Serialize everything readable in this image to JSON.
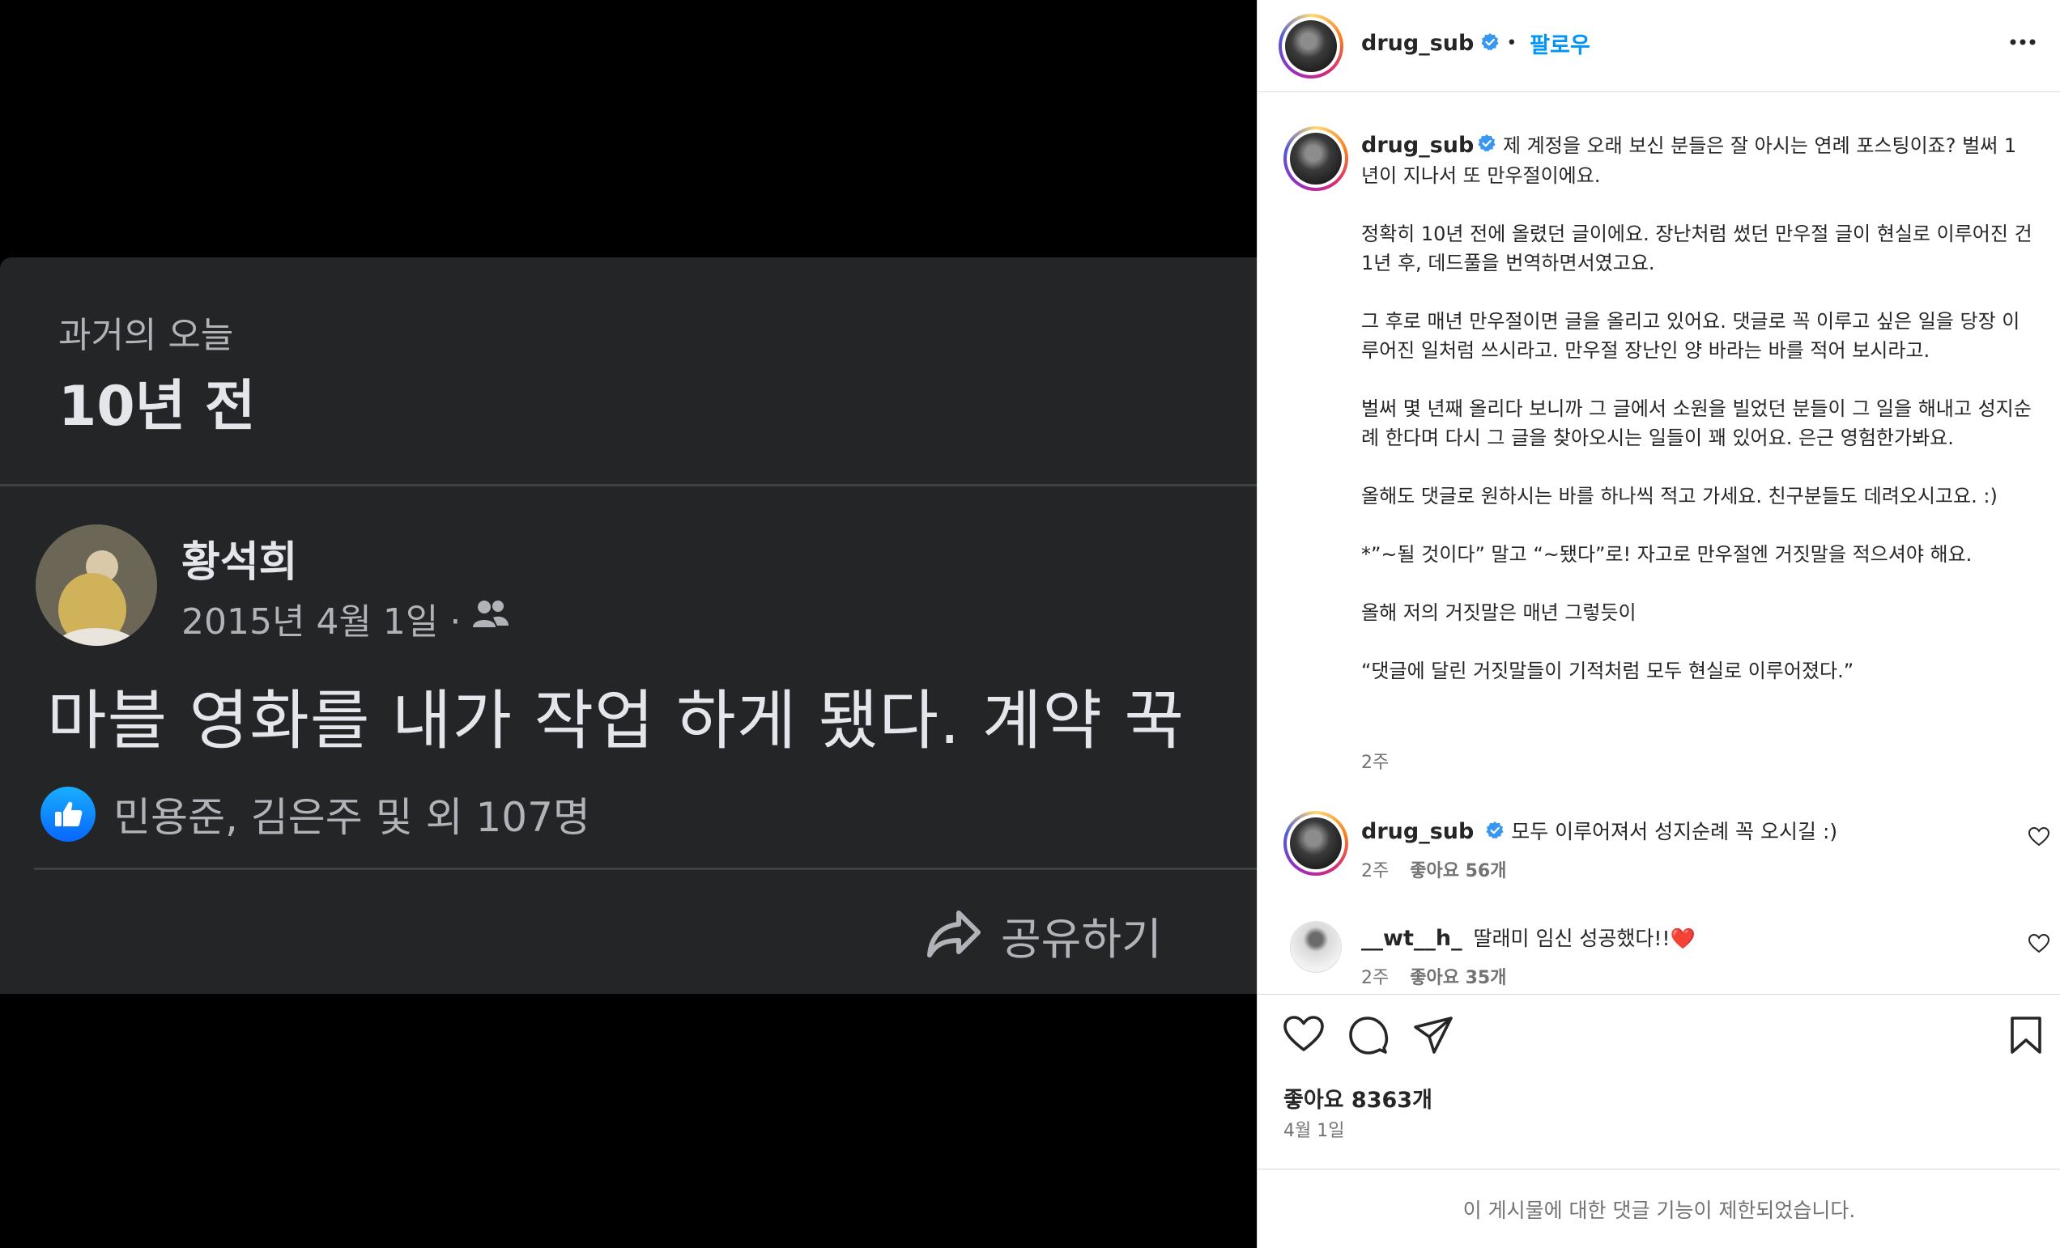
{
  "media": {
    "memory_label": "과거의 오늘",
    "years_ago": "10년 전",
    "author": "황석희",
    "date": "2015년 4월 1일 ·",
    "post_text": "마블 영화를 내가 작업 하게 됐다. 계약 꾹",
    "likes_text": "민용준, 김은주 및 외 107명",
    "share_label": "공유하기"
  },
  "header": {
    "username": "drug_sub",
    "separator": "•",
    "follow_label": "팔로우"
  },
  "caption": {
    "username": "drug_sub",
    "text": "제 계정을 오래 보신 분들은 잘 아시는 연례 포스팅이죠? 벌써 1년이 지나서 또 만우절이에요.\n\n정확히 10년 전에 올렸던 글이에요. 장난처럼 썼던 만우절 글이 현실로 이루어진 건 1년 후, 데드풀을 번역하면서였고요.\n\n그 후로 매년 만우절이면 글을 올리고 있어요. 댓글로 꼭 이루고 싶은 일을 당장 이루어진 일처럼 쓰시라고. 만우절 장난인 양 바라는 바를 적어 보시라고.\n\n벌써 몇 년째 올리다 보니까 그 글에서 소원을 빌었던 분들이 그 일을 해내고 성지순례 한다며 다시 그 글을 찾아오시는 일들이 꽤 있어요. 은근 영험한가봐요.\n\n올해도 댓글로 원하시는 바를 하나씩 적고 가세요. 친구분들도 데려오시고요. :)\n\n*”~될 것이다” 말고 “~됐다”로! 자고로 만우절엔 거짓말을 적으셔야 해요.\n\n올해 저의 거짓말은 매년 그렇듯이\n\n“댓글에 달린 거짓말들이 기적처럼 모두 현실로 이루어졌다.”",
    "time": "2주"
  },
  "comments": [
    {
      "username": "drug_sub",
      "text": "모두 이루어져서 성지순례 꼭 오시길 :)",
      "time": "2주",
      "likes": "좋아요 56개",
      "verified": true
    },
    {
      "username": "__wt__h_",
      "text": "딸래미 임신 성공했다!!❤️",
      "time": "2주",
      "likes": "좋아요 35개",
      "verified": false
    }
  ],
  "footer": {
    "likes": "좋아요 8363개",
    "date": "4월 1일",
    "restricted_notice": "이 게시물에 대한 댓글 기능이 제한되었습니다."
  },
  "colors": {
    "fb_bg": "#242526",
    "ig_blue": "#0095f6",
    "verified_blue": "#3897f0"
  },
  "icons": [
    "like-thumb-icon",
    "friends-icon",
    "share-arrow-icon",
    "verified-icon",
    "more-icon",
    "heart-icon",
    "comment-icon",
    "send-icon",
    "bookmark-icon"
  ]
}
